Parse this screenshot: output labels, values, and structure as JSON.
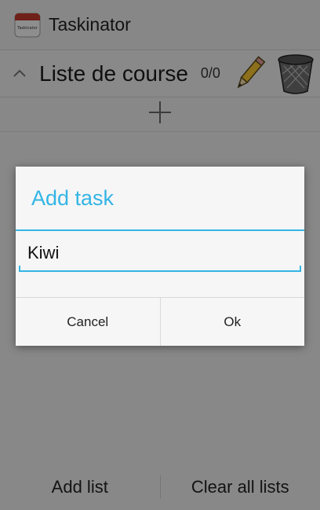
{
  "app": {
    "title": "Taskinator",
    "icon": "notebook-app-icon",
    "icon_label": "Taskinator"
  },
  "list": {
    "title": "Liste de course",
    "count": "0/0",
    "collapse_icon": "chevron-up-icon",
    "edit_icon": "pencil-icon",
    "delete_icon": "trash-can-icon",
    "add_icon": "plus-icon"
  },
  "dialog": {
    "title": "Add task",
    "input_value": "Kiwi",
    "cancel_label": "Cancel",
    "ok_label": "Ok",
    "accent_color": "#33b5e5"
  },
  "bottom_bar": {
    "add_list_label": "Add list",
    "clear_all_label": "Clear all lists"
  }
}
